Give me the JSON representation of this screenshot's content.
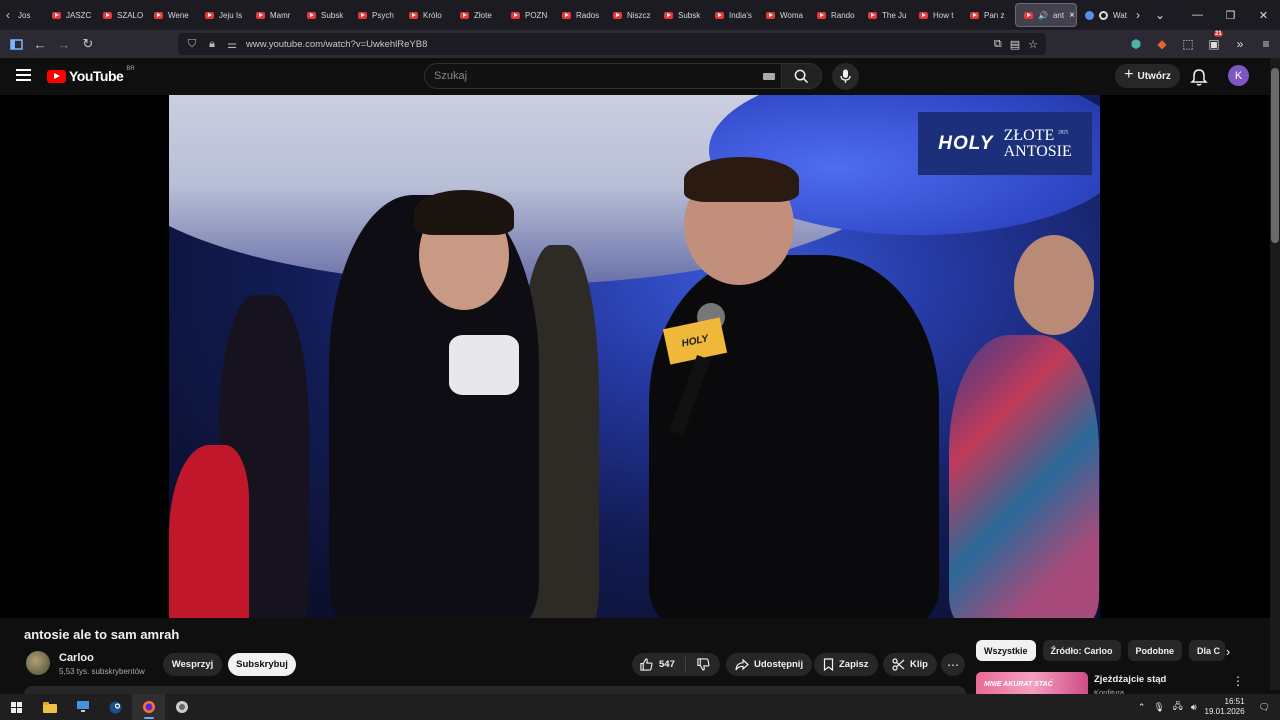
{
  "browser": {
    "tabs": [
      {
        "label": "Jos"
      },
      {
        "label": "JASZC"
      },
      {
        "label": "SZALO"
      },
      {
        "label": "Wene"
      },
      {
        "label": "Jeju Is"
      },
      {
        "label": "Mamr"
      },
      {
        "label": "Subsk"
      },
      {
        "label": "Psych"
      },
      {
        "label": "Królo"
      },
      {
        "label": "Złote"
      },
      {
        "label": "POZN"
      },
      {
        "label": "Rados"
      },
      {
        "label": "Niszcz"
      },
      {
        "label": "Subsk"
      },
      {
        "label": "India's"
      },
      {
        "label": "Woma"
      },
      {
        "label": "Rando"
      },
      {
        "label": "The Ju"
      },
      {
        "label": "How t"
      },
      {
        "label": "Pan z"
      }
    ],
    "active_tab": {
      "label": "ant",
      "close": "×"
    },
    "extra_tab": {
      "label": "Wat"
    },
    "url": "www.youtube.com/watch?v=UwkehlReYB8",
    "ext_badge": "21"
  },
  "youtube": {
    "logo_text": "YouTube",
    "country_code": "BR",
    "search_placeholder": "Szukaj",
    "create_label": "Utwórz",
    "avatar_letter": "K"
  },
  "video": {
    "overlay_brand": "HOLY",
    "overlay_title_line1": "ZŁOTE",
    "overlay_title_line2": "ANTOSIE",
    "overlay_year": "2025",
    "mic_label": "HOLY"
  },
  "meta": {
    "title": "antosie ale to sam amrah",
    "channel": "Carloo",
    "subscribers": "5,53 tys. subskrybentów",
    "support_label": "Wesprzyj",
    "subscribe_label": "Subskrybuj",
    "likes": "547",
    "share_label": "Udostępnij",
    "save_label": "Zapisz",
    "clip_label": "Klip"
  },
  "sidebar": {
    "chips": [
      {
        "label": "Wszystkie",
        "active": true
      },
      {
        "label": "Źródło: Carloo",
        "active": false
      },
      {
        "label": "Podobne",
        "active": false
      },
      {
        "label": "Dla C",
        "active": false
      }
    ],
    "recommended": {
      "title": "Zjeżdżajcie stąd",
      "channel": "Konfitura",
      "thumb_text": "MNIE AKURAT STAĆ"
    }
  },
  "taskbar": {
    "time": "16:51",
    "date": "19.01.2026"
  },
  "colors": {
    "yt_red": "#ff0000",
    "background": "#0f0f0f",
    "avatar": "#7e57c2",
    "overlay_bg": "#1b2f7a",
    "mic_label": "#f0b83a"
  }
}
